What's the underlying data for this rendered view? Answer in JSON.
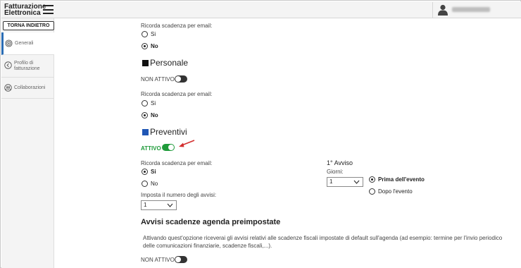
{
  "app": {
    "title_line1": "Fatturazione",
    "title_line2": "Elettronica"
  },
  "sidebar": {
    "back_label": "TORNA INDIETRO",
    "items": [
      {
        "label": "Generali"
      },
      {
        "label_line1": "Profilo di",
        "label_line2": "fatturazione"
      },
      {
        "label": "Collaborazioni"
      }
    ]
  },
  "top_section": {
    "question": "Ricorda scadenza per email:",
    "opt_si": "Si",
    "opt_no": "No",
    "selected": "No"
  },
  "personale": {
    "title": "Personale",
    "color": "#111111",
    "status": "NON ATTIVO",
    "question": "Ricorda scadenza per email:",
    "opt_si": "Si",
    "opt_no": "No",
    "selected": "No"
  },
  "preventivi": {
    "title": "Preventivi",
    "color": "#1f56b5",
    "status": "ATTIVO",
    "status_color": "#1f9b3a",
    "question": "Ricorda scadenza per email:",
    "opt_si": "Si",
    "opt_no": "No",
    "selected": "Si",
    "count_label": "Imposta il numero degli avvisi:",
    "count_value": "1",
    "avviso": {
      "title": "1° Avviso",
      "days_label": "Giorni:",
      "days_value": "1",
      "opt_prima": "Prima dell'evento",
      "opt_dopo": "Dopo l'evento",
      "selected": "Prima dell'evento"
    }
  },
  "agenda": {
    "title": "Avvisi scadenze agenda preimpostate",
    "description": "Attivando quest'opzione riceverai gli avvisi relativi alle scadenze fiscali impostate di default sull'agenda (ad esempio: termine per l'invio periodico delle comunicazioni finanziarie, scadenze fiscali,...).",
    "status": "NON ATTIVO"
  },
  "annotation": {
    "arrow_color": "#d32f2f"
  }
}
